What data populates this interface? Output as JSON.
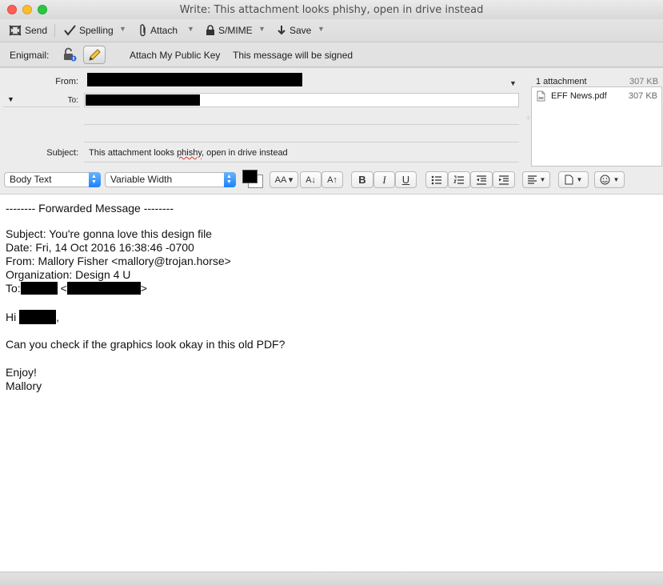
{
  "window": {
    "title": "Write: This attachment looks phishy, open in drive instead"
  },
  "toolbar": {
    "send": "Send",
    "spelling": "Spelling",
    "attach": "Attach",
    "smime": "S/MIME",
    "save": "Save"
  },
  "enigmail": {
    "label": "Enigmail:",
    "attach_key": "Attach My Public Key",
    "signed_status": "This message will be signed"
  },
  "headers": {
    "from_label": "From:",
    "to_label": "To:",
    "subject_label": "Subject:",
    "subject_before": "This attachment looks ",
    "subject_misspelled": "phishy",
    "subject_after": ", open in drive instead"
  },
  "attachments": {
    "count_label": "1 attachment",
    "total_size": "307 KB",
    "items": [
      {
        "name": "EFF News.pdf",
        "size": "307 KB"
      }
    ]
  },
  "format": {
    "paragraph_style": "Body Text",
    "font": "Variable Width",
    "text_color": "#000000",
    "bold": "B",
    "italic": "I",
    "underline": "U"
  },
  "body": {
    "line1": "-------- Forwarded Message --------",
    "line2": "Subject: You're gonna love this design file",
    "line3": "Date: Fri, 14 Oct 2016 16:38:46 -0700",
    "line4": "From: Mallory Fisher <mallory@trojan.horse>",
    "line5": "Organization: Design 4 U",
    "to_prefix": "To:",
    "to_open": "<",
    "to_close": ">",
    "hi_prefix": "Hi",
    "hi_suffix": ",",
    "line8": "Can you check if the graphics look okay in this old PDF?",
    "line9": "Enjoy!",
    "line10": "Mallory"
  }
}
